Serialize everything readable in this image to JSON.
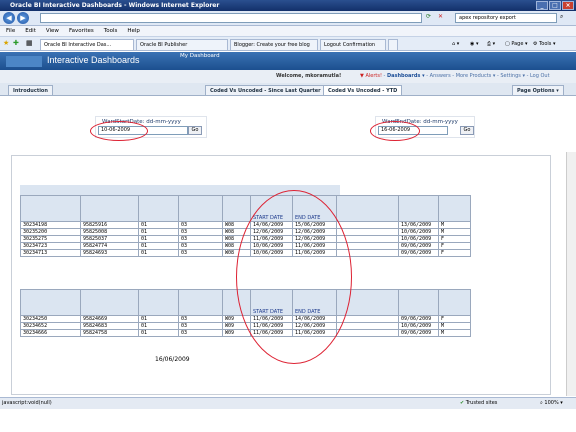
{
  "window": {
    "title": "Oracle BI Interactive Dashboards - Windows Internet Explorer",
    "search_value": "apex repository export"
  },
  "menu": [
    "File",
    "Edit",
    "View",
    "Favorites",
    "Tools",
    "Help"
  ],
  "browser_tabs": [
    {
      "label": "Oracle BI Interactive Das..."
    },
    {
      "label": "Oracle BI Publisher"
    },
    {
      "label": "Blogger: Create your free blog"
    },
    {
      "label": "Logout Confirmation"
    }
  ],
  "toolbar_right": {
    "page_label": "Page",
    "tools_label": "Tools"
  },
  "obi": {
    "app_title": "Interactive Dashboards",
    "my_dashboard": "My Dashboard",
    "welcome": "Welcome, mkoramutla!",
    "links": {
      "alerts": "Alerts!",
      "dashboards": "Dashboards",
      "answers": "Answers",
      "more_products": "More Products",
      "settings": "Settings",
      "logout": "Log Out"
    }
  },
  "page_tabs": {
    "introduction": "Introduction",
    "tab1": "Coded Vs Uncoded - Since Last Quarter",
    "tab2": "Coded Vs Uncoded - YTD",
    "page_options": "Page Options"
  },
  "prompts": {
    "start": {
      "label": "WardStartDate: dd-mm-yyyy",
      "value": "10-06-2009",
      "go": "Go"
    },
    "end": {
      "label": "WardEndDate: dd-mm-yyyy",
      "value": "16-06-2009",
      "go": "Go"
    }
  },
  "table1": {
    "headers": {
      "start": "START DATE",
      "end": "END DATE"
    },
    "rows": [
      [
        "30234198",
        "95825916",
        "01",
        "03",
        "W08",
        "14/06/2009",
        "15/06/2009",
        "13/06/2009",
        "M"
      ],
      [
        "30235200",
        "95825008",
        "01",
        "03",
        "W08",
        "12/06/2009",
        "12/06/2009",
        "10/06/2009",
        "M"
      ],
      [
        "30235275",
        "95825037",
        "01",
        "03",
        "W08",
        "11/06/2009",
        "12/06/2009",
        "10/06/2009",
        "F"
      ],
      [
        "30234723",
        "95824774",
        "01",
        "03",
        "W08",
        "10/06/2009",
        "11/06/2009",
        "09/06/2009",
        "F"
      ],
      [
        "30234713",
        "95824693",
        "01",
        "03",
        "W08",
        "10/06/2009",
        "11/06/2009",
        "09/06/2009",
        "F"
      ]
    ]
  },
  "table2": {
    "headers": {
      "start": "START DATE",
      "end": "END DATE"
    },
    "rows": [
      [
        "30234250",
        "95824669",
        "01",
        "03",
        "W09",
        "11/06/2009",
        "14/06/2009",
        "09/06/2009",
        "F"
      ],
      [
        "30234652",
        "95824683",
        "01",
        "03",
        "W09",
        "11/06/2009",
        "12/06/2009",
        "10/06/2009",
        "M"
      ],
      [
        "30234666",
        "95824758",
        "01",
        "03",
        "W09",
        "11/06/2009",
        "11/06/2009",
        "09/06/2009",
        "M"
      ]
    ]
  },
  "footer_date": "16/06/2009",
  "status": {
    "left": "javascript:void(null)",
    "zone": "Trusted sites",
    "zoom": "100%"
  }
}
